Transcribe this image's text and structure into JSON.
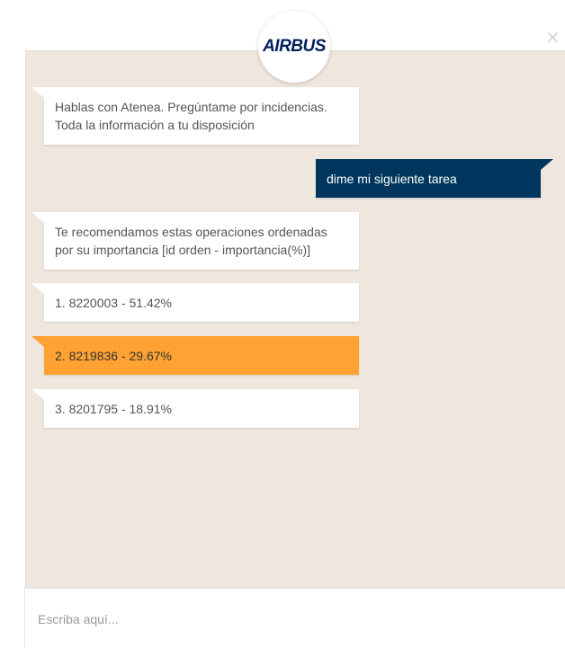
{
  "header": {
    "logo_text": "AIRBUS",
    "close_icon": "close-icon",
    "close_glyph": "×"
  },
  "messages": [
    {
      "from": "bot",
      "text": "Hablas con Atenea. Pregúntame por incidencias. Toda la información a tu disposición",
      "highlighted": false
    },
    {
      "from": "user",
      "text": "dime mi siguiente tarea"
    },
    {
      "from": "bot",
      "text": "Te recomendamos estas operaciones ordenadas por su importancia [id orden - importancia(%)]",
      "highlighted": false
    },
    {
      "from": "bot",
      "text": "1. 8220003 - 51.42%",
      "highlighted": false
    },
    {
      "from": "bot",
      "text": "2. 8219836 - 29.67%",
      "highlighted": true
    },
    {
      "from": "bot",
      "text": "3. 8201795 - 18.91%",
      "highlighted": false
    }
  ],
  "input": {
    "placeholder": "Escriba aquí...",
    "value": ""
  },
  "colors": {
    "panel_bg": "#efe6de",
    "user_bubble": "#00365d",
    "highlight_bubble": "#ffa233",
    "logo": "#00205b"
  }
}
